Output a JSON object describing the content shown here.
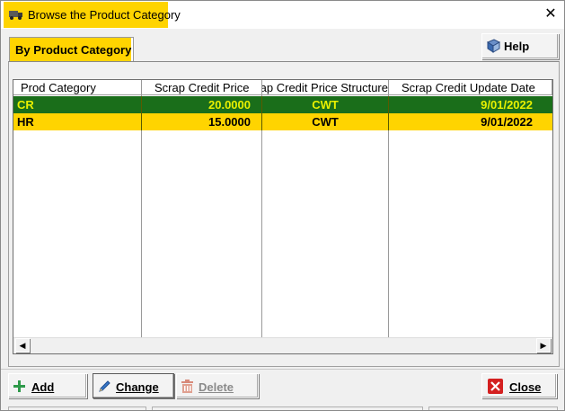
{
  "window": {
    "title": "Browse the Product Category",
    "accent_color": "#ffd400"
  },
  "tab": {
    "label": "By Product Category"
  },
  "help_button": {
    "label": "Help",
    "icon": "book-help-icon"
  },
  "grid": {
    "columns": [
      "Prod Category",
      "Scrap Credit Price",
      "Scrap Credit Price Structure",
      "Scrap Credit Update Date"
    ],
    "rows": [
      {
        "prod_category": "CR",
        "price": "20.0000",
        "structure": "CWT",
        "update_date": "9/01/2022",
        "selected": true
      },
      {
        "prod_category": "HR",
        "price": "15.0000",
        "structure": "CWT",
        "update_date": "9/01/2022",
        "selected": false
      }
    ],
    "selected_row_color": "#1a6e1a",
    "selected_text_color": "#e8f000"
  },
  "buttons": {
    "add": "Add",
    "change": "Change",
    "delete": "Delete",
    "close": "Close"
  }
}
